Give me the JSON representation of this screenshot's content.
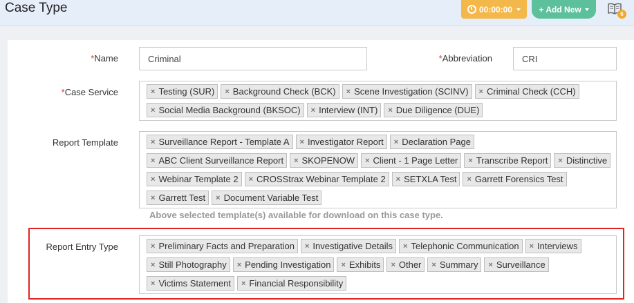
{
  "header": {
    "title": "Case Type",
    "timer_label": "00:00:00",
    "add_new_label": "Add New",
    "notification_count": "6"
  },
  "form": {
    "name_label": "Name",
    "name_value": "Criminal",
    "abbreviation_label": "Abbreviation",
    "abbreviation_value": "CRI",
    "case_service_label": "Case Service",
    "case_services": [
      "Testing (SUR)",
      "Background Check (BCK)",
      "Scene Investigation (SCINV)",
      "Criminal Check (CCH)",
      "Social Media Background (BKSOC)",
      "Interview (INT)",
      "Due Diligence (DUE)"
    ],
    "report_template_label": "Report Template",
    "report_templates": [
      "Surveillance Report - Template A",
      "Investigator Report",
      "Declaration Page",
      "ABC Client Surveillance Report",
      "SKOPENOW",
      "Client - 1 Page Letter",
      "Transcribe Report",
      "Distinctive",
      "Webinar Template 2",
      "CROSStrax Webinar Template 2",
      "SETXLA Test",
      "Garrett Forensics Test",
      "Garrett Test",
      "Document Variable Test"
    ],
    "template_help": "Above selected template(s) available for download on this case type.",
    "report_entry_type_label": "Report Entry Type",
    "report_entry_types": [
      "Preliminary Facts and Preparation",
      "Investigative Details",
      "Telephonic Communication",
      "Interviews",
      "Still Photography",
      "Pending Investigation",
      "Exhibits",
      "Other",
      "Summary",
      "Surveillance",
      "Victims Statement",
      "Financial Responsibility"
    ]
  },
  "colors": {
    "timer": "#f4b74a",
    "add_new": "#5cc09a",
    "required": "#d9352a",
    "highlight": "#e02424"
  }
}
